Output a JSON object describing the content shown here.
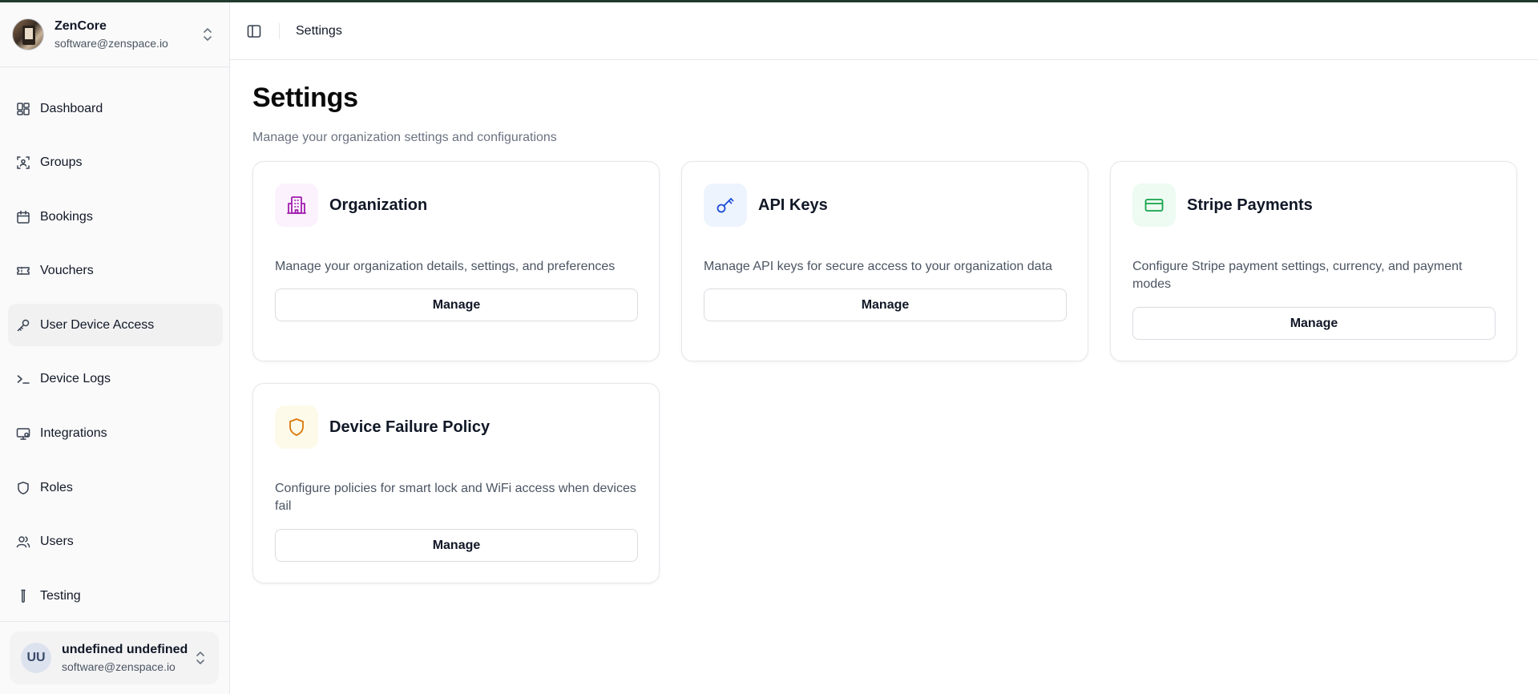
{
  "org": {
    "name": "ZenCore",
    "email": "software@zenspace.io"
  },
  "sidebar": {
    "items": [
      {
        "label": "Dashboard",
        "icon": "dashboard-icon"
      },
      {
        "label": "Groups",
        "icon": "groups-icon"
      },
      {
        "label": "Bookings",
        "icon": "calendar-icon"
      },
      {
        "label": "Vouchers",
        "icon": "ticket-icon"
      },
      {
        "label": "User Device Access",
        "icon": "key-icon",
        "active": true
      },
      {
        "label": "Device Logs",
        "icon": "terminal-icon"
      },
      {
        "label": "Integrations",
        "icon": "monitor-icon"
      },
      {
        "label": "Roles",
        "icon": "shield-icon"
      },
      {
        "label": "Users",
        "icon": "users-icon"
      },
      {
        "label": "Testing",
        "icon": "test-tube-icon"
      }
    ]
  },
  "user": {
    "initials": "UU",
    "name": "undefined undefined",
    "email": "software@zenspace.io"
  },
  "header": {
    "breadcrumb": "Settings"
  },
  "main": {
    "title": "Settings",
    "subtitle": "Manage your organization settings and configurations",
    "cards": [
      {
        "title": "Organization",
        "description": "Manage your organization details, settings, and preferences",
        "button": "Manage",
        "icon": "building-icon",
        "icon_color": "#a21caf",
        "icon_bg": "#fbf2fd"
      },
      {
        "title": "API Keys",
        "description": "Manage API keys for secure access to your organization data",
        "button": "Manage",
        "icon": "key-icon",
        "icon_color": "#1d4ed8",
        "icon_bg": "#eef4fe"
      },
      {
        "title": "Stripe Payments",
        "description": "Configure Stripe payment settings, currency, and payment modes",
        "button": "Manage",
        "icon": "credit-card-icon",
        "icon_color": "#16a34a",
        "icon_bg": "#edfbf2"
      },
      {
        "title": "Device Failure Policy",
        "description": "Configure policies for smart lock and WiFi access when devices fail",
        "button": "Manage",
        "icon": "shield-icon",
        "icon_color": "#d97706",
        "icon_bg": "#fefaea"
      }
    ]
  }
}
